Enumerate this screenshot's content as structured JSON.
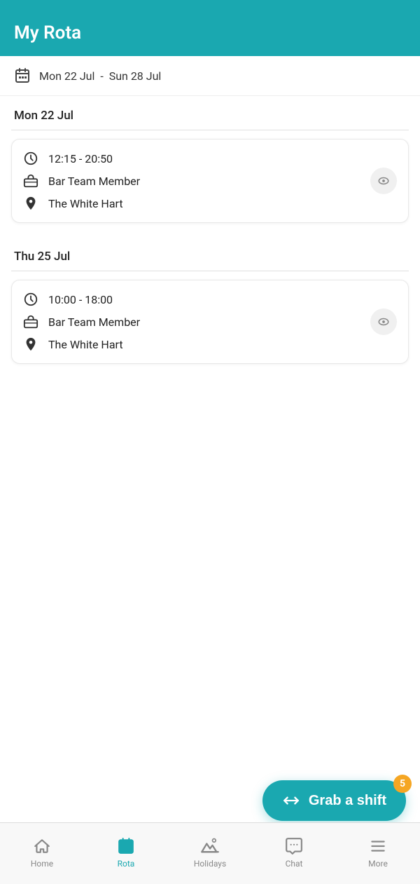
{
  "header": {
    "title": "My Rota"
  },
  "dateRange": {
    "start": "Mon 22 Jul",
    "separator": "-",
    "end": "Sun 28 Jul"
  },
  "days": [
    {
      "label": "Mon 22 Jul",
      "shifts": [
        {
          "time": "12:15 - 20:50",
          "role": "Bar Team Member",
          "location": "The White Hart"
        }
      ]
    },
    {
      "label": "Thu 25 Jul",
      "shifts": [
        {
          "time": "10:00 - 18:00",
          "role": "Bar Team Member",
          "location": "The White Hart"
        }
      ]
    }
  ],
  "fab": {
    "label": "Grab a shift",
    "badge": "5"
  },
  "nav": {
    "items": [
      {
        "id": "home",
        "label": "Home",
        "active": false
      },
      {
        "id": "rota",
        "label": "Rota",
        "active": true
      },
      {
        "id": "holidays",
        "label": "Holidays",
        "active": false
      },
      {
        "id": "chat",
        "label": "Chat",
        "active": false
      },
      {
        "id": "more",
        "label": "More",
        "active": false
      }
    ]
  }
}
